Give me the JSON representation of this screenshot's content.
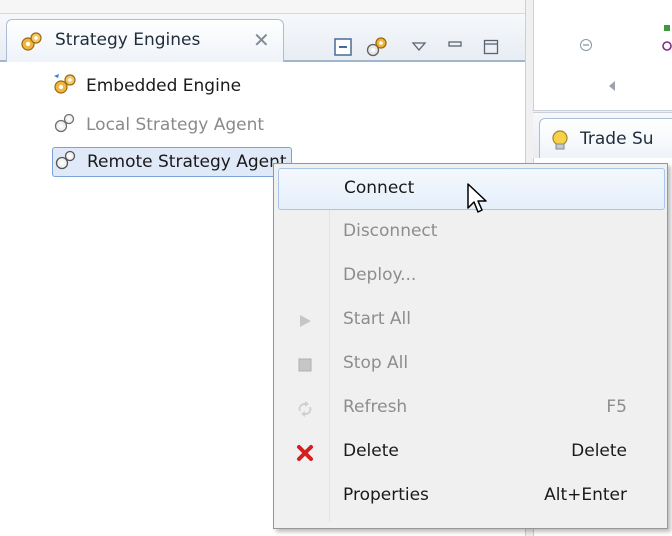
{
  "view": {
    "tab_title": "Strategy Engines",
    "tab_icon": "engines-icon",
    "toolbar": [
      "collapse-all-icon",
      "engine-config-icon",
      "view-menu-icon",
      "minimize-icon",
      "maximize-icon"
    ]
  },
  "tree": [
    {
      "label": "Embedded Engine",
      "icon": "embedded-engine-icon",
      "state": "normal"
    },
    {
      "label": "Local Strategy Agent",
      "icon": "gear-pair-icon",
      "state": "disabled"
    },
    {
      "label": "Remote Strategy Agent",
      "icon": "gear-pair-icon",
      "state": "selected"
    }
  ],
  "right_panel": {
    "tab_title": "Trade Su",
    "tab_icon": "lightbulb-icon"
  },
  "menu": {
    "items": [
      {
        "label": "Connect",
        "shortcut": "",
        "enabled": true,
        "icon": ""
      },
      {
        "label": "Disconnect",
        "shortcut": "",
        "enabled": false,
        "icon": ""
      },
      {
        "label": "Deploy...",
        "shortcut": "",
        "enabled": false,
        "icon": ""
      },
      {
        "label": "Start All",
        "shortcut": "",
        "enabled": false,
        "icon": "play-icon"
      },
      {
        "label": "Stop All",
        "shortcut": "",
        "enabled": false,
        "icon": "stop-icon"
      },
      {
        "label": "Refresh",
        "shortcut": "F5",
        "enabled": false,
        "icon": "refresh-icon"
      },
      {
        "label": "Delete",
        "shortcut": "Delete",
        "enabled": true,
        "icon": "delete-icon"
      },
      {
        "label": "Properties",
        "shortcut": "Alt+Enter",
        "enabled": true,
        "icon": ""
      }
    ]
  },
  "colors": {
    "selection": "#dfe9f7",
    "delete_red": "#d42020",
    "disabled_text": "#8d8d8d"
  }
}
